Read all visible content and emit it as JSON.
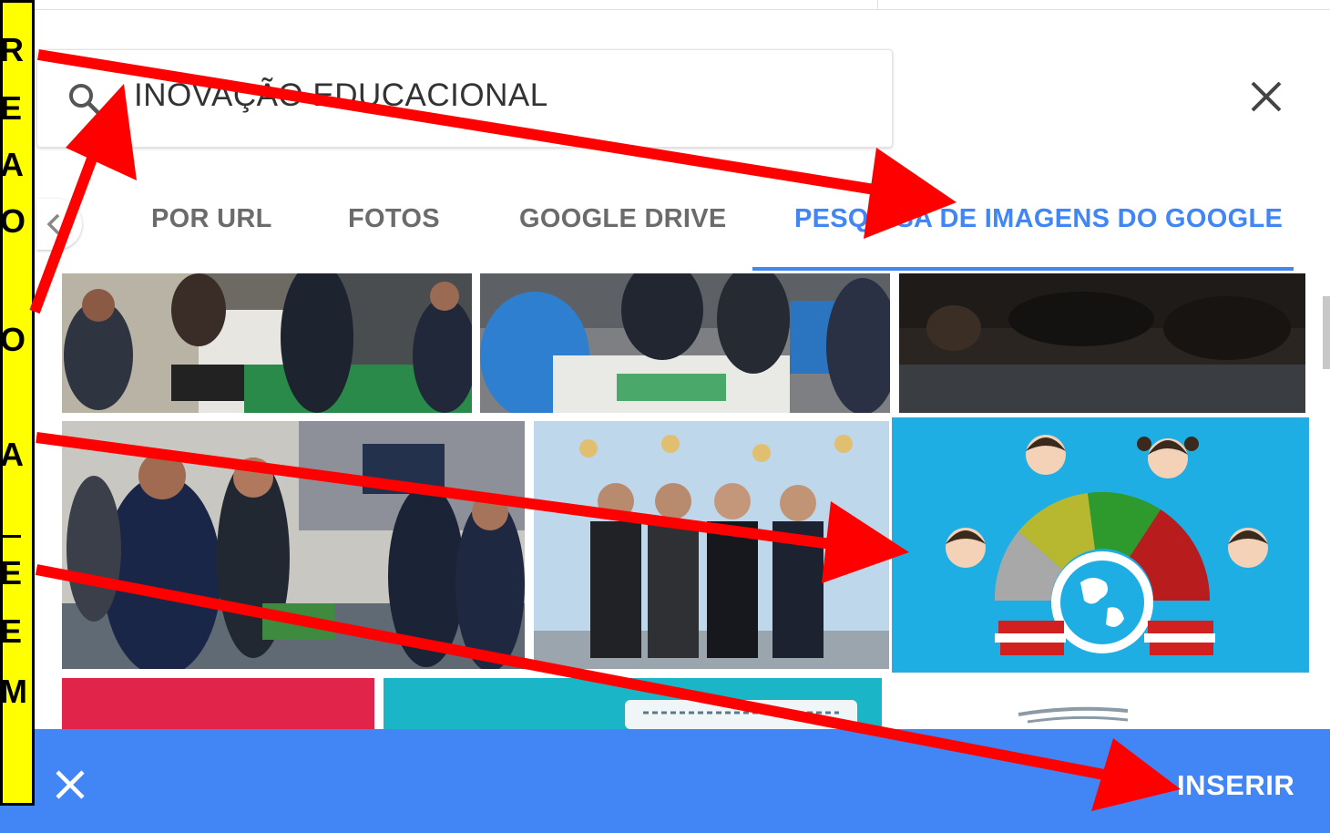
{
  "search": {
    "query": "INOVAÇÃO EDUCACIONAL",
    "search_icon": "search-icon",
    "clear_icon": "close-icon"
  },
  "tabs": [
    {
      "label": "POR URL",
      "active": false
    },
    {
      "label": "FOTOS",
      "active": false
    },
    {
      "label": "GOOGLE DRIVE",
      "active": false
    },
    {
      "label": "PESQUISA DE IMAGENS DO GOOGLE",
      "active": true
    }
  ],
  "footer": {
    "cancel_icon": "close-icon",
    "insert_label": "INSERIR"
  },
  "annotation": {
    "letters": [
      "R",
      "E",
      "A",
      "O",
      "O",
      "A",
      "E",
      "E",
      "M"
    ]
  },
  "colors": {
    "accent": "#4285f4",
    "annotation_arrow": "#ff0000",
    "annotation_label": "#ffff00"
  }
}
